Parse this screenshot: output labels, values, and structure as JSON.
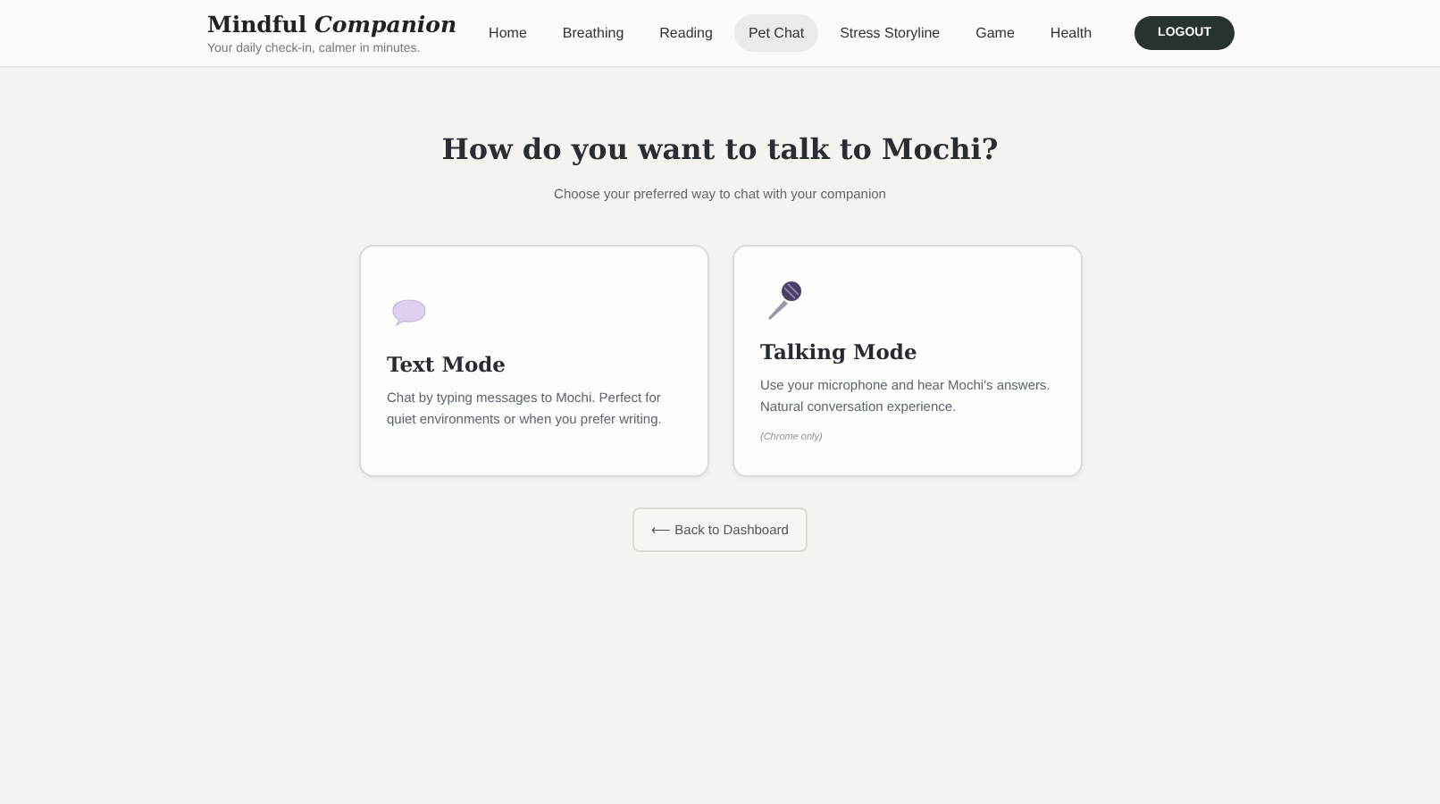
{
  "header": {
    "logo": "Mindful *Companion*",
    "tagline": "Your daily check-in, calmer in minutes.",
    "nav": [
      {
        "label": "Home",
        "selected": false
      },
      {
        "label": "Breathing",
        "selected": false
      },
      {
        "label": "Reading",
        "selected": false
      },
      {
        "label": "Pet Chat",
        "selected": true
      },
      {
        "label": "Stress Storyline",
        "selected": false
      },
      {
        "label": "Game",
        "selected": false
      },
      {
        "label": "Health",
        "selected": false
      }
    ],
    "logout": "LOGOUT"
  },
  "heading": "How do you want to talk to Mochi?",
  "subheading": "Choose your preferred way to chat with your companion",
  "modes": [
    {
      "kind": "text",
      "title": "Text Mode",
      "description": "Chat by typing messages to Mochi. Perfect for quiet environments or when you prefer writing."
    },
    {
      "kind": "talking",
      "title": "Talking Mode",
      "description": "Use your microphone and hear Mochi's answers. Natural conversation experience.",
      "note": "(Chrome only)"
    }
  ],
  "back_button": "⟵ Back to Dashboard"
}
